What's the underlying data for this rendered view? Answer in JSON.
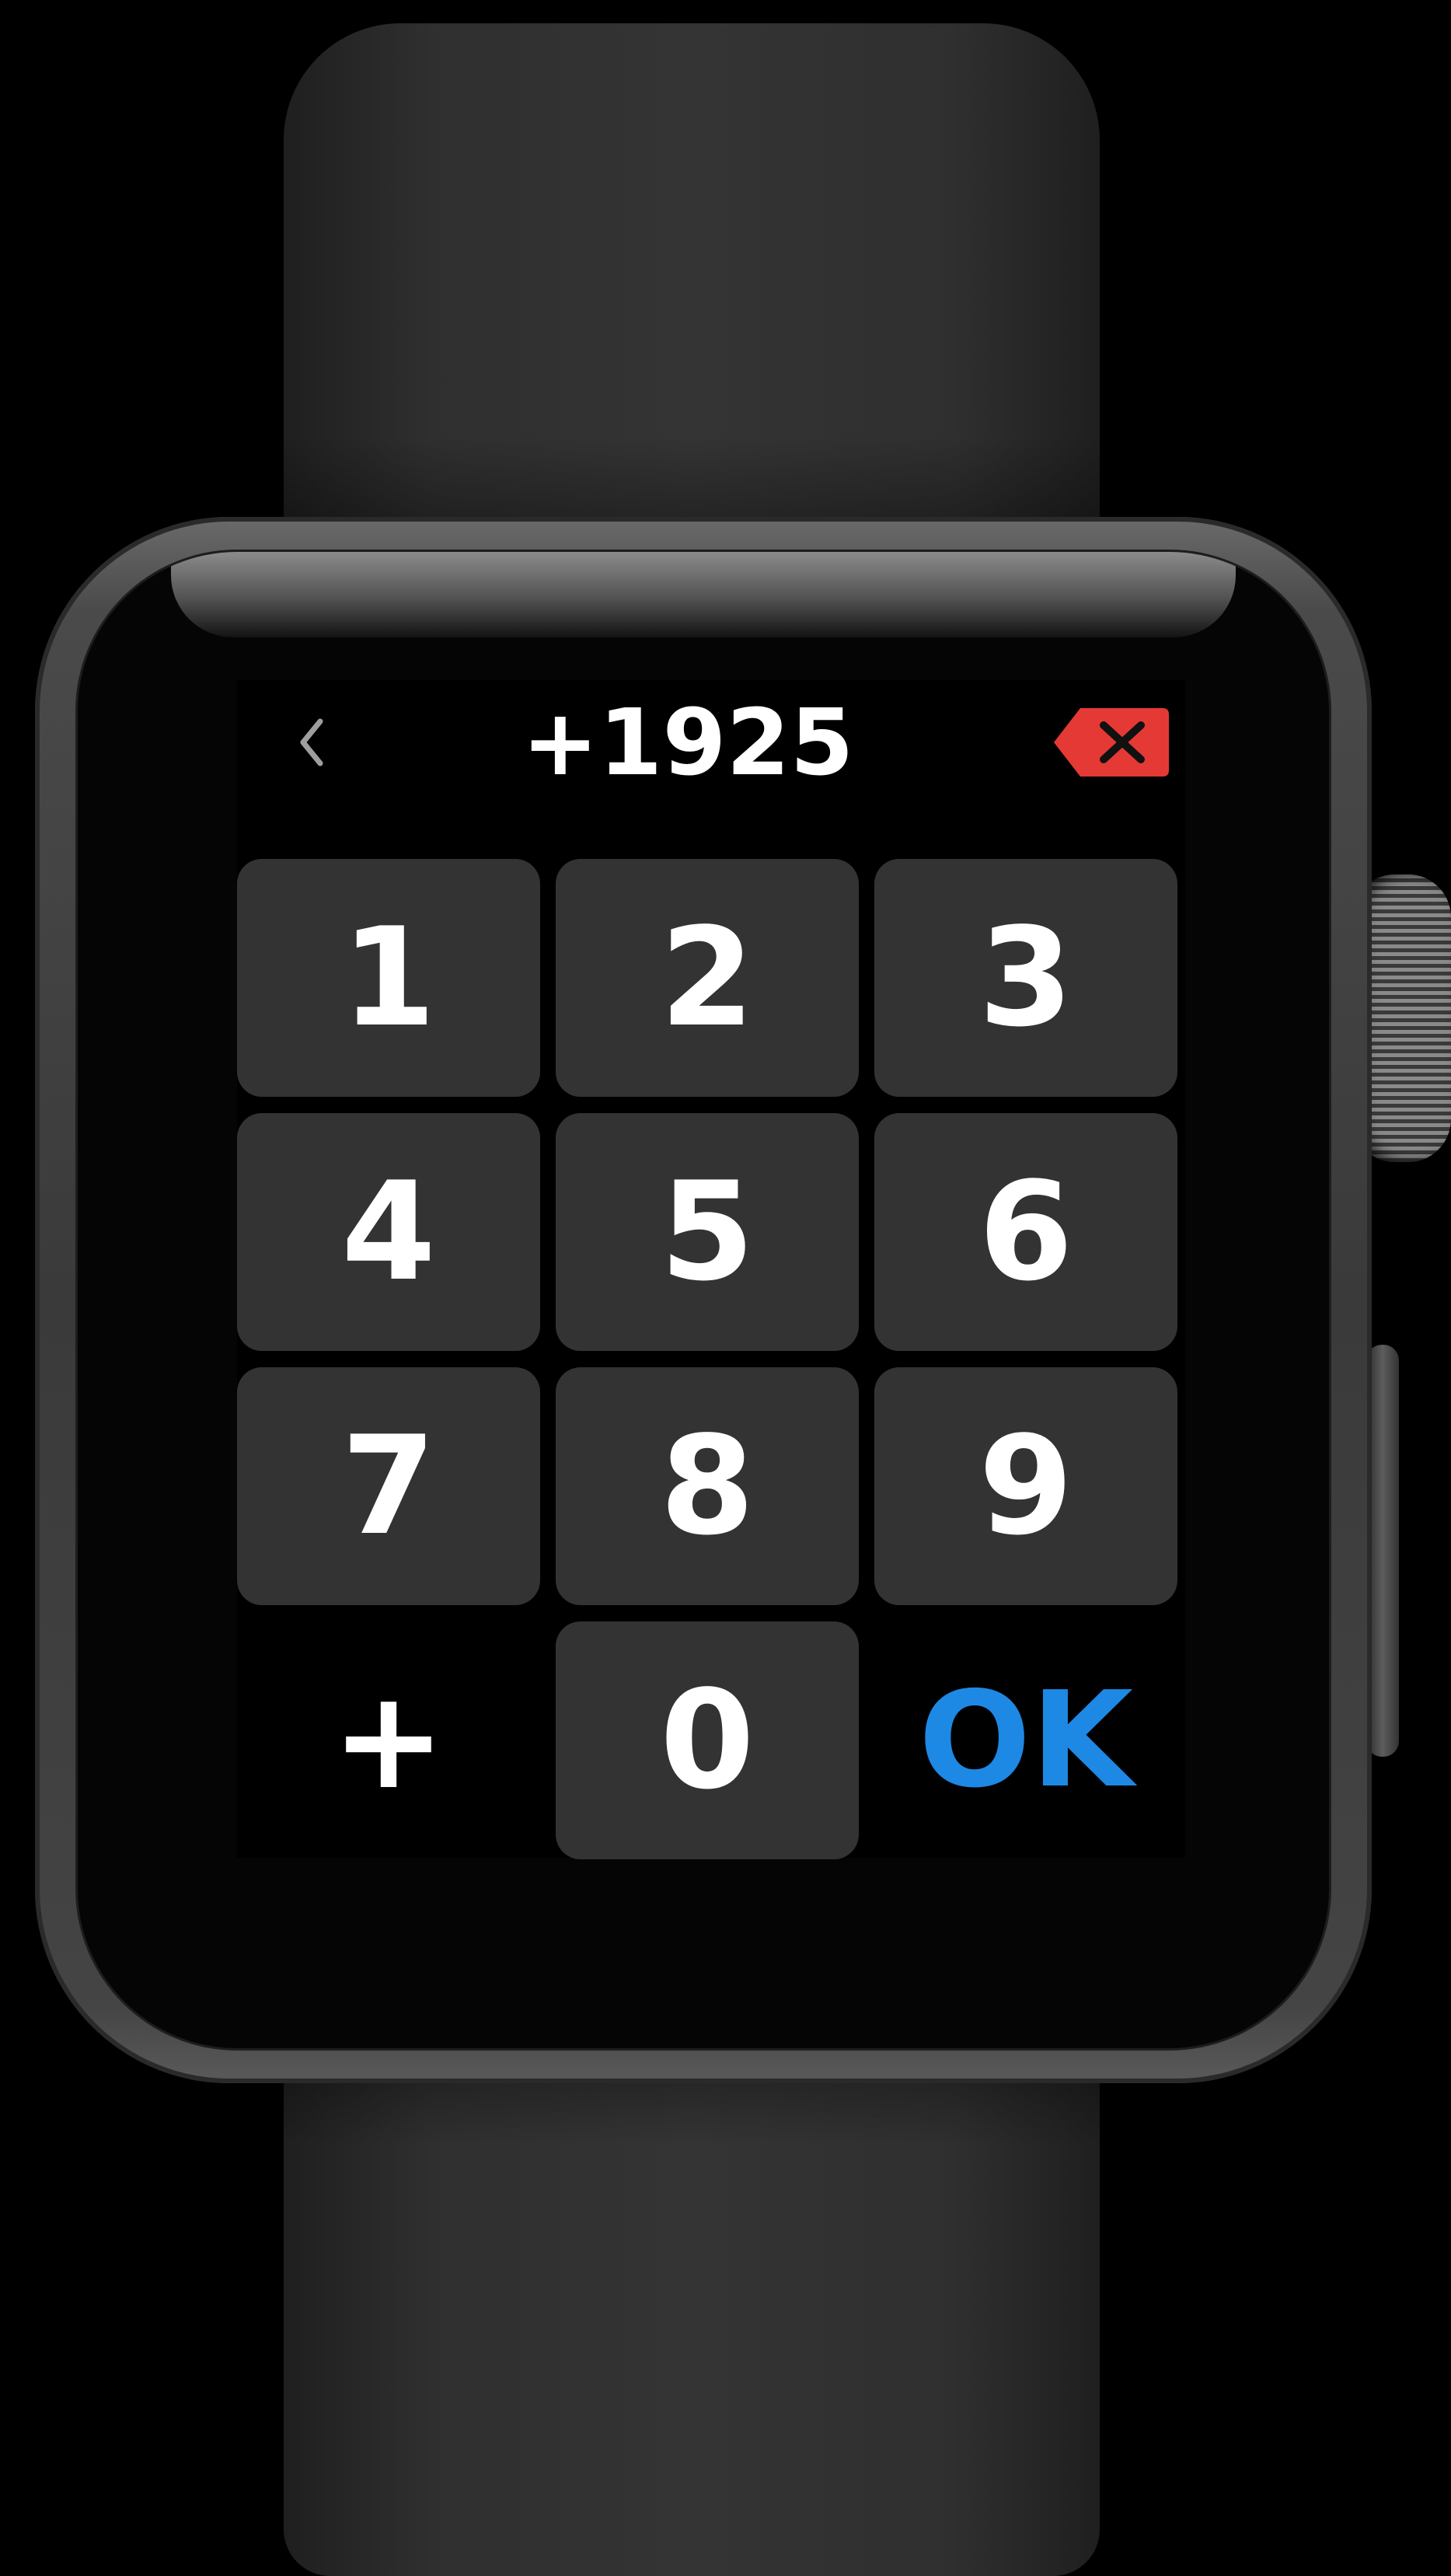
{
  "dialer": {
    "number": "+1925",
    "keys": [
      "1",
      "2",
      "3",
      "4",
      "5",
      "6",
      "7",
      "8",
      "9",
      "+",
      "0",
      "OK"
    ]
  },
  "icons": {
    "back": "chevron-left-icon",
    "delete": "backspace-icon"
  },
  "colors": {
    "background": "#000000",
    "key_fill": "#333333",
    "key_text": "#ffffff",
    "ok_text": "#1e88e5",
    "delete_fill": "#e53935",
    "back_chevron": "#9e9e9e"
  }
}
